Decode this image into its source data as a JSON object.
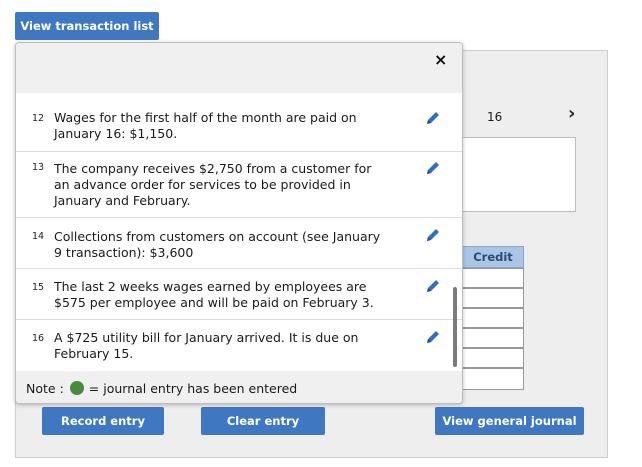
{
  "toolbar": {
    "view_transactions_label": "View transaction list"
  },
  "background_panel": {
    "entry_number": "16",
    "credit_header": "Credit",
    "buttons": {
      "record": "Record entry",
      "clear": "Clear entry",
      "view_general": "View general journal"
    }
  },
  "popup": {
    "close_symbol": "×",
    "items": [
      {
        "number": "12",
        "text": "Wages for the first half of the month are paid on January 16: $1,150."
      },
      {
        "number": "13",
        "text": "The company receives $2,750 from a customer for an advance order for services to be provided in January and February."
      },
      {
        "number": "14",
        "text": "Collections from customers on account (see January 9 transaction): $3,600"
      },
      {
        "number": "15",
        "text": "The last 2 weeks wages earned by employees are $575 per employee and will be paid on February 3."
      },
      {
        "number": "16",
        "text": "A $725 utility bill for January arrived. It is due on February 15."
      }
    ],
    "note": {
      "label": "Note :",
      "text": "= journal entry has been entered"
    }
  },
  "colors": {
    "button": "#3f78c0",
    "credit_header": "#a9c6e6",
    "entered_dot": "#4a8a3e"
  },
  "icons": {
    "edit": "pencil-icon",
    "next": "chevron-right-icon",
    "close": "close-icon"
  }
}
